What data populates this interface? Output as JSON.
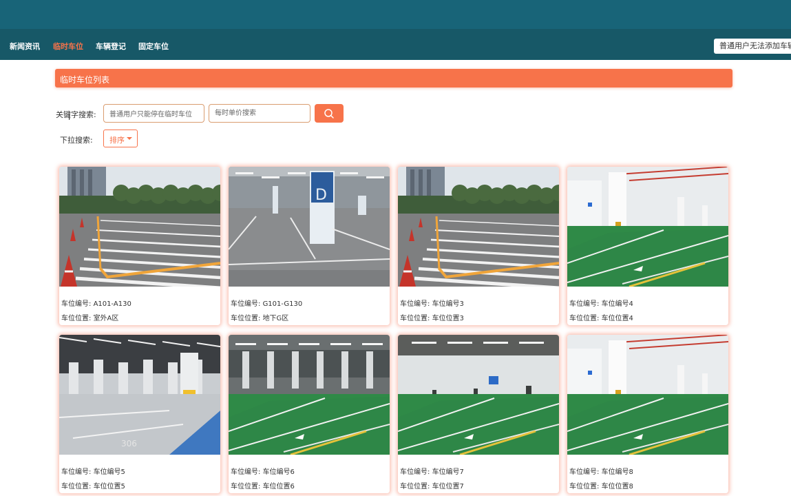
{
  "nav": {
    "items": [
      {
        "label": "新闻资讯"
      },
      {
        "label": "临时车位"
      },
      {
        "label": "车辆登记"
      },
      {
        "label": "固定车位"
      }
    ],
    "notice": "普通用户无法添加车辆"
  },
  "section": {
    "title": "临时车位列表"
  },
  "search": {
    "keyword_label": "关键字搜索:",
    "keyword_value": "普通用户只能停在临时车位",
    "price_placeholder": "每时单价搜索",
    "dropdown_label": "下拉搜索:",
    "sort_label": "排序"
  },
  "cards": [
    {
      "id_label": "车位编号:",
      "id": "A101-A130",
      "loc_label": "车位位置:",
      "loc": "室外A区",
      "scene": "outdoor"
    },
    {
      "id_label": "车位编号:",
      "id": "G101-G130",
      "loc_label": "车位位置:",
      "loc": "地下G区",
      "scene": "underground-grey"
    },
    {
      "id_label": "车位编号:",
      "id": "车位编号3",
      "loc_label": "车位位置:",
      "loc": "车位位置3",
      "scene": "outdoor"
    },
    {
      "id_label": "车位编号:",
      "id": "车位编号4",
      "loc_label": "车位位置:",
      "loc": "车位位置4",
      "scene": "underground-green"
    },
    {
      "id_label": "车位编号:",
      "id": "车位编号5",
      "loc_label": "车位位置:",
      "loc": "车位位置5",
      "scene": "underground-blue"
    },
    {
      "id_label": "车位编号:",
      "id": "车位编号6",
      "loc_label": "车位位置:",
      "loc": "车位位置6",
      "scene": "underground-green-dark"
    },
    {
      "id_label": "车位编号:",
      "id": "车位编号7",
      "loc_label": "车位位置:",
      "loc": "车位位置7",
      "scene": "underground-green-charging"
    },
    {
      "id_label": "车位编号:",
      "id": "车位编号8",
      "loc_label": "车位位置:",
      "loc": "车位位置8",
      "scene": "underground-green"
    }
  ],
  "colors": {
    "header": "#186478",
    "navbar": "#175867",
    "accent": "#f7734a"
  }
}
